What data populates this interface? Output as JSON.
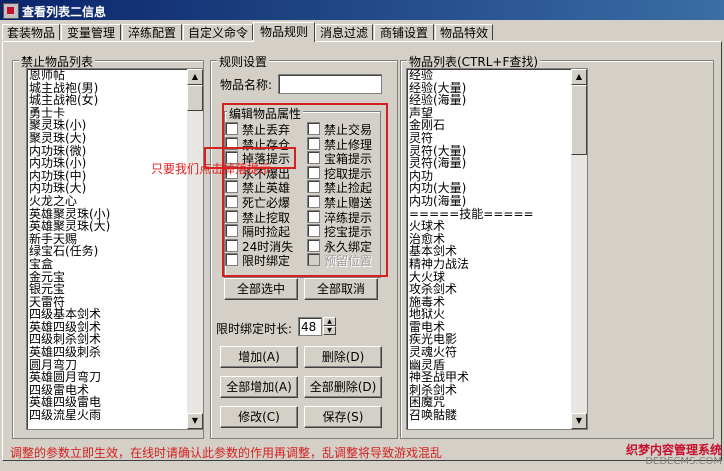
{
  "window": {
    "title": "查看列表二信息"
  },
  "tabs": [
    "套装物品",
    "变量管理",
    "淬练配置",
    "自定义命令",
    "物品规则",
    "消息过滤",
    "商铺设置",
    "物品特效"
  ],
  "active_tab": "物品规则",
  "banned_list": {
    "title": "禁止物品列表",
    "items": [
      "恩师帖",
      "城主战袍(男)",
      "城主战袍(女)",
      "勇士卡",
      "聚灵珠(小)",
      "聚灵珠(大)",
      "内功珠(微)",
      "内功珠(小)",
      "内功珠(中)",
      "内功珠(大)",
      "火龙之心",
      "英雄聚灵珠(小)",
      "英雄聚灵珠(大)",
      "新手天赐",
      "绿宝石(任务)",
      "宝盒",
      "金元宝",
      "银元宝",
      "天雷符",
      "四级基本剑术",
      "英雄四级剑术",
      "四级刺杀剑术",
      "英雄四级刺杀",
      "圆月弯刀",
      "英雄圆月弯刀",
      "四级雷电术",
      "英雄四级雷电",
      "四级流星火雨"
    ]
  },
  "rules": {
    "title": "规则设置",
    "name_label": "物品名称:",
    "name_value": "",
    "attr_group_title": "编辑物品属性",
    "left_checks": [
      "禁止丢弃",
      "禁止存仓",
      "掉落提示",
      "永不爆出",
      "禁止英雄",
      "死亡必爆",
      "禁止挖取",
      "隔时捡起",
      "24时消失",
      "限时绑定"
    ],
    "right_checks": [
      "禁止交易",
      "禁止修理",
      "宝箱提示",
      "挖取提示",
      "禁止捡起",
      "禁止赠送",
      "淬练提示",
      "挖宝提示",
      "永久绑定",
      "预留位置"
    ],
    "select_all": "全部选中",
    "deselect_all": "全部取消",
    "bind_time_label": "限时绑定时长:",
    "bind_time_value": "48",
    "add": "增加(A)",
    "delete": "删除(D)",
    "add_all": "全部增加(A)",
    "delete_all": "全部删除(D)",
    "modify": "修改(C)",
    "save": "保存(S)"
  },
  "annotation": "只要我们点击掉落提示",
  "item_list": {
    "title": "物品列表(CTRL+F查找)",
    "items": [
      "经验",
      "经验(大量)",
      "经验(海量)",
      "声望",
      "金刚石",
      "灵符",
      "灵符(大量)",
      "灵符(海量)",
      "内功",
      "内功(大量)",
      "内功(海量)",
      "=====技能=====",
      "火球术",
      "治愈术",
      "基本剑术",
      "精神力战法",
      "大火球",
      "攻杀剑术",
      "施毒术",
      "地狱火",
      "雷电术",
      "疾光电影",
      "灵魂火符",
      "幽灵盾",
      "神圣战甲术",
      "刺杀剑术",
      "困魔咒",
      "召唤骷髅"
    ]
  },
  "status": "调整的参数立即生效，在线时请确认此参数的作用再调整，乱调整将导致游戏混乱",
  "watermark": {
    "line1": "织梦内容管理系统",
    "line2": "DEDECMS.COM"
  },
  "colors": {
    "annotation": "#d42020",
    "title_bar": "#0a246a"
  }
}
